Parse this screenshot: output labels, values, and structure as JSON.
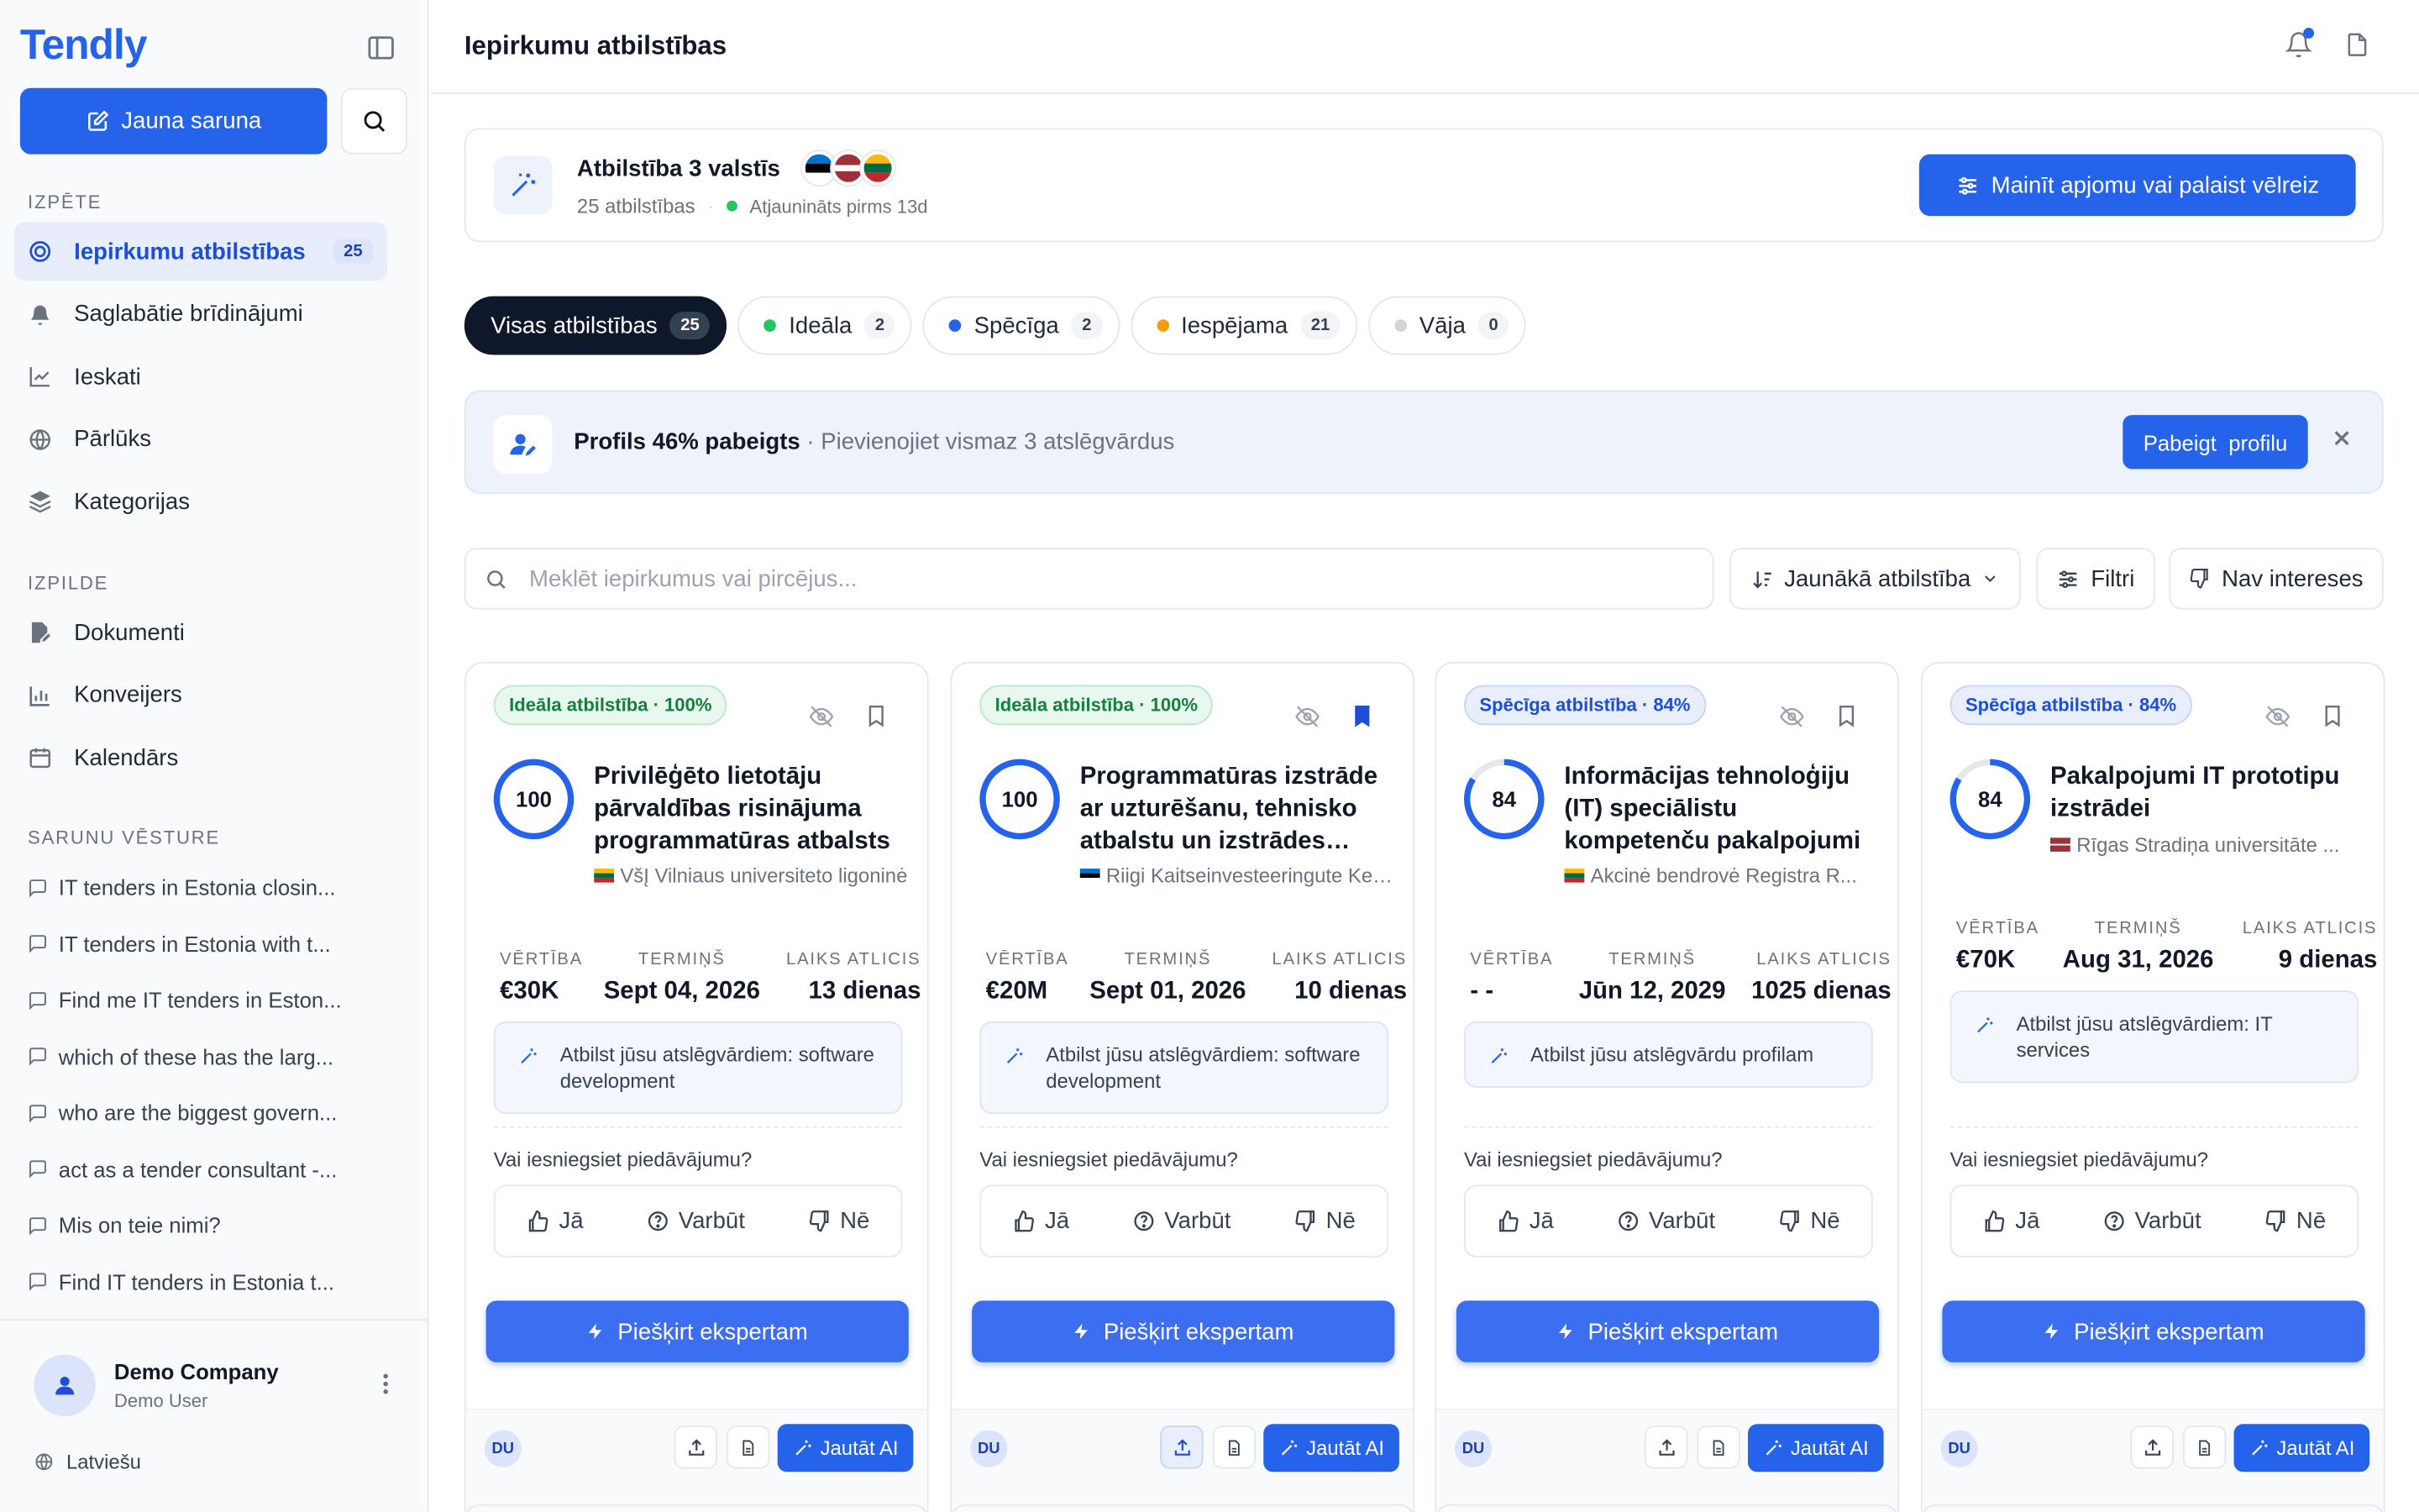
{
  "sidebar": {
    "logo": "Tendly",
    "new_chat": "Jauna saruna",
    "sections": {
      "explore": "IZPĒTE",
      "execute": "IZPILDE",
      "history": "SARUNU VĒSTURE"
    },
    "explore_items": [
      {
        "label": "Iepirkumu atbilstības",
        "count": "25",
        "icon": "target-icon"
      },
      {
        "label": "Saglabātie brīdinājumi",
        "icon": "bell-icon"
      },
      {
        "label": "Ieskati",
        "icon": "line-chart-icon"
      },
      {
        "label": "Pārlūks",
        "icon": "globe-icon"
      },
      {
        "label": "Kategorijas",
        "icon": "layers-icon"
      }
    ],
    "execute_items": [
      {
        "label": "Dokumenti",
        "icon": "file-edit-icon"
      },
      {
        "label": "Konveijers",
        "icon": "bar-chart-icon"
      },
      {
        "label": "Kalendārs",
        "icon": "calendar-icon"
      }
    ],
    "history": [
      "IT tenders in Estonia closin...",
      "IT tenders in Estonia with t...",
      "Find me IT tenders in Eston...",
      "which of these has the larg...",
      "who are the biggest govern...",
      "act as a tender consultant -...",
      "Mis on teie nimi?",
      "Find IT tenders in Estonia t..."
    ],
    "user": {
      "name": "Demo Company",
      "sub": "Demo User"
    },
    "language": "Latviešu"
  },
  "header": {
    "title": "Iepirkumu atbilstības"
  },
  "summary": {
    "title": "Atbilstība 3 valstīs",
    "count_text": "25 atbilstības",
    "updated": "Atjaunināts pirms 13d",
    "rerun_label": "Mainīt apjomu vai palaist vēlreiz",
    "flags": [
      "estonia",
      "latvia",
      "lithuania"
    ]
  },
  "filters": [
    {
      "label": "Visas atbilstības",
      "count": "25",
      "dot": ""
    },
    {
      "label": "Ideāla",
      "count": "2",
      "dot": "#22c55e"
    },
    {
      "label": "Spēcīga",
      "count": "2",
      "dot": "#2563eb"
    },
    {
      "label": "Iespējama",
      "count": "21",
      "dot": "#f59e0b"
    },
    {
      "label": "Vāja",
      "count": "0",
      "dot": "#d1d5db"
    }
  ],
  "banner": {
    "bold": "Profils 46% pabeigts",
    "rest": " · Pievienojiet vismaz 3 atslēgvārdus",
    "button": "Pabeigt  profilu"
  },
  "toolbar": {
    "search_placeholder": "Meklēt iepirkumus vai pircējus...",
    "sort_label": "Jaunākā atbilstība",
    "filters_label": "Filtri",
    "not_interested_label": "Nav intereses"
  },
  "card_labels": {
    "value": "VĒRTĪBA",
    "deadline": "TERMIŅŠ",
    "time_left": "LAIKS ATLICIS",
    "question": "Vai iesniegsiet piedāvājumu?",
    "yes": "Jā",
    "maybe": "Varbūt",
    "no": "Nē",
    "assign": "Piešķirt ekspertam",
    "ask_ai": "Jautāt AI",
    "avatar": "DU"
  },
  "cards": [
    {
      "badge": "Ideāla atbilstība · 100%",
      "type": "ideal",
      "score": "100",
      "score_pct": 100,
      "title": "Privilēģēto lietotāju pārvaldības risinājuma programmatūras atbalsts",
      "buyer": "VšĮ Vilniaus universiteto ligoninė",
      "flag": "lithuania",
      "value": "€30K",
      "deadline": "Sept 04, 2026",
      "left": "13 dienas",
      "match": "Atbilst jūsu atslēgvārdiem: software development",
      "bookmarked": false,
      "share_active": false
    },
    {
      "badge": "Ideāla atbilstība · 100%",
      "type": "ideal",
      "score": "100",
      "score_pct": 100,
      "title": "Programmatūras izstrāde ar uzturēšanu, tehnisko atbalstu un izstrādes pakalpojumiem",
      "buyer": "Riigi Kaitseinvesteeringute Keskus",
      "flag": "estonia",
      "value": "€20M",
      "deadline": "Sept 01, 2026",
      "left": "10 dienas",
      "match": "Atbilst jūsu atslēgvārdiem: software development",
      "bookmarked": true,
      "share_active": true
    },
    {
      "badge": "Spēcīga atbilstība · 84%",
      "type": "strong",
      "score": "84",
      "score_pct": 84,
      "title": "Informācijas tehnoloģiju (IT) speciālistu kompetenču pakalpojumi",
      "buyer": "Akcinė bendrovė Registra  R...",
      "flag": "lithuania",
      "value": "- -",
      "deadline": "Jūn 12, 2029",
      "left": "1025 dienas",
      "match": "Atbilst jūsu atslēgvārdu profilam",
      "bookmarked": false,
      "share_active": false
    },
    {
      "badge": "Spēcīga atbilstība · 84%",
      "type": "strong",
      "score": "84",
      "score_pct": 84,
      "title": "Pakalpojumi IT prototipu izstrādei",
      "buyer": "Rīgas Stradiņa universitāte  ...",
      "flag": "latvia",
      "value": "€70K",
      "deadline": "Aug 31, 2026",
      "left": "9 dienas",
      "match": "Atbilst jūsu atslēgvārdiem: IT services",
      "bookmarked": false,
      "share_active": false
    }
  ]
}
